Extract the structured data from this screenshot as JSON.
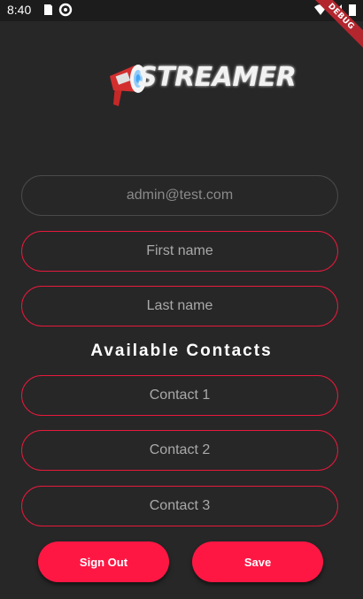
{
  "status_bar": {
    "time": "8:40",
    "icons": [
      "sd-card-icon",
      "sync-icon",
      "wifi-icon",
      "signal-icon",
      "battery-icon"
    ]
  },
  "debug_banner": "DEBUG",
  "logo": {
    "text": "STREAMER",
    "icon": "megaphone-icon"
  },
  "form": {
    "email_value": "admin@test.com",
    "first_name_placeholder": "First name",
    "last_name_placeholder": "Last name"
  },
  "contacts": {
    "title": "Available Contacts",
    "fields": [
      {
        "placeholder": "Contact 1"
      },
      {
        "placeholder": "Contact 2"
      },
      {
        "placeholder": "Contact 3"
      }
    ]
  },
  "buttons": {
    "sign_out": "Sign Out",
    "save": "Save"
  },
  "colors": {
    "background": "#272727",
    "accent": "#ff1744",
    "border_pink": "#e8193c"
  }
}
